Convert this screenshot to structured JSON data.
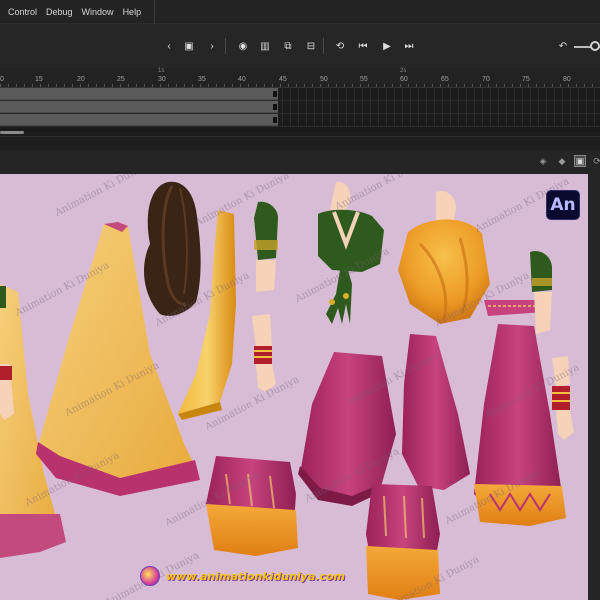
{
  "menu": {
    "items": [
      "Control",
      "Debug",
      "Window",
      "Help"
    ]
  },
  "toolbar": {
    "buttons": [
      {
        "name": "prev-keyframe-button",
        "glyph": "‹"
      },
      {
        "name": "insert-keyframe-button",
        "glyph": "▣"
      },
      {
        "name": "next-keyframe-button",
        "glyph": "›"
      },
      {
        "name": "onion-skin-button",
        "glyph": "◉"
      },
      {
        "name": "edit-multiple-frames-button",
        "glyph": "▥"
      },
      {
        "name": "create-motion-tween-button",
        "glyph": "⧉"
      },
      {
        "name": "insert-blank-keyframe-button",
        "glyph": "⊟"
      },
      {
        "name": "loop-button",
        "glyph": "⟲"
      },
      {
        "name": "step-back-button",
        "glyph": "⏮"
      },
      {
        "name": "play-button",
        "glyph": "▶"
      },
      {
        "name": "step-forward-button",
        "glyph": "⏭"
      },
      {
        "name": "undo-zoom-button",
        "glyph": "↶"
      }
    ]
  },
  "ruler": {
    "frame_labels": [
      "0",
      "15",
      "20",
      "25",
      "30",
      "35",
      "40",
      "45",
      "50",
      "55",
      "60",
      "65",
      "70",
      "75",
      "80"
    ],
    "second_labels": [
      "1s",
      "2s"
    ]
  },
  "stage_header": {
    "buttons": [
      {
        "name": "clip-content-icon",
        "glyph": "◈",
        "active": false
      },
      {
        "name": "fill-color-icon",
        "glyph": "◆",
        "active": false
      },
      {
        "name": "center-stage-icon",
        "glyph": "▣",
        "active": true
      },
      {
        "name": "rotate-stage-icon",
        "glyph": "⟳",
        "active": false
      }
    ]
  },
  "canvas": {
    "watermark": "Animation Ki Duniya",
    "app_badge": "An",
    "footer_url": "www.animationkiduniya.com",
    "background": "#d8bcd6"
  },
  "colors": {
    "gold": "#eab64a",
    "gold_light": "#f2c56a",
    "magenta": "#b8336e",
    "magenta_dark": "#8e1f52",
    "green": "#2f5a1d",
    "skin": "#f5d2b8",
    "hair": "#3a2416",
    "orange": "#f0a02c"
  }
}
